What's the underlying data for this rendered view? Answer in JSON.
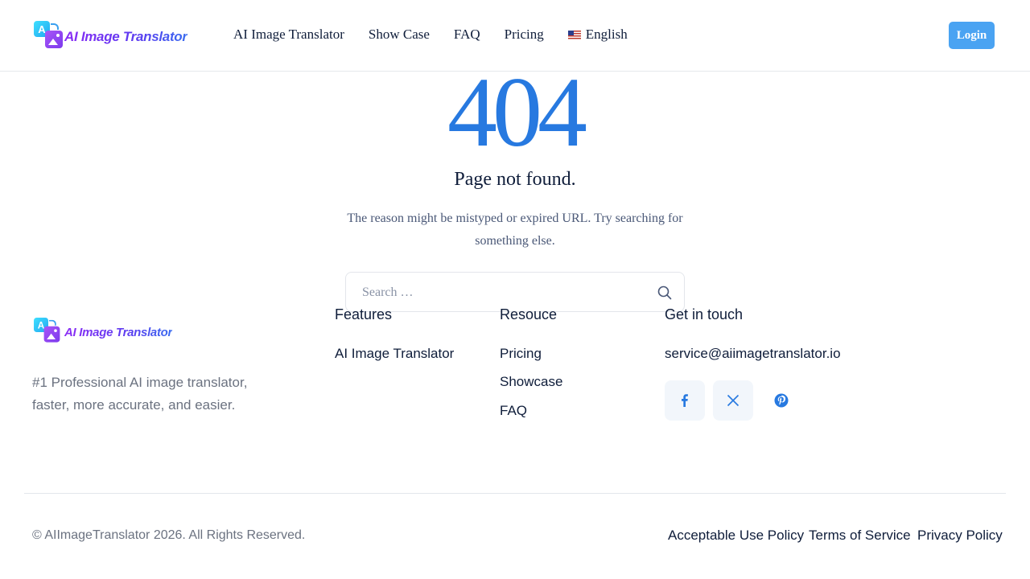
{
  "header": {
    "logo_letter": "A",
    "logo_text": "AI Image Translator",
    "nav": [
      "AI Image Translator",
      "Show Case",
      "FAQ",
      "Pricing"
    ],
    "language": "English",
    "login_label": "Login"
  },
  "main": {
    "code": "404",
    "title": "Page not found.",
    "description": "The reason might be mistyped or expired URL. Try searching for something else.",
    "search_placeholder": "Search …"
  },
  "footer": {
    "logo_text": "AI Image Translator",
    "tagline": "#1 Professional AI image translator, faster, more accurate, and easier.",
    "features": {
      "title": "Features",
      "links": [
        "AI Image Translator"
      ]
    },
    "resource": {
      "title": "Resouce",
      "links": [
        "Pricing",
        "Showcase",
        "FAQ"
      ]
    },
    "contact": {
      "title": "Get in touch",
      "email": "service@aiimagetranslator.io"
    },
    "social_icons": [
      "facebook-icon",
      "x-icon",
      "pinterest-icon"
    ],
    "copyright": "© AIImageTranslator 2026. All Rights Reserved.",
    "legal": [
      "Acceptable Use Policy",
      "Terms of Service",
      "Privacy Policy"
    ]
  },
  "colors": {
    "accent": "#2779e0",
    "login_bg": "#4aa3f2",
    "text_dark": "#0f1d3a",
    "text_muted": "#6b7280"
  }
}
